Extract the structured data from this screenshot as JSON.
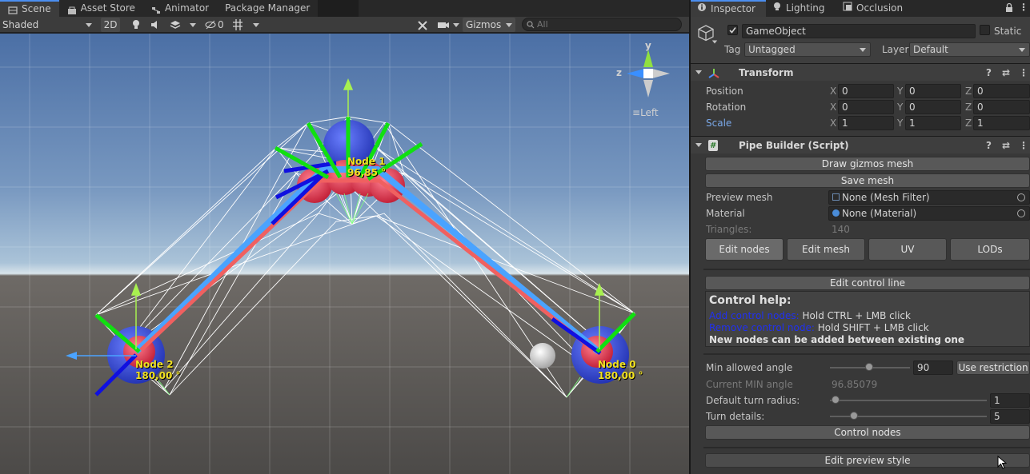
{
  "scene_panel": {
    "tabs": [
      {
        "label": "Scene",
        "icon": "scene-icon"
      },
      {
        "label": "Asset Store",
        "icon": "asset-store-icon"
      },
      {
        "label": "Animator",
        "icon": "animator-icon"
      },
      {
        "label": "Package Manager",
        "icon": ""
      }
    ],
    "toolbar": {
      "draw_mode": "Shaded",
      "mode_2d": "2D",
      "hidden_count": "0",
      "gizmos": "Gizmos",
      "search_placeholder": "All"
    },
    "orientation_gizmo": {
      "y": "y",
      "z": "z",
      "view_label": "Left"
    },
    "nodes": [
      {
        "name": "Node 1",
        "angle": "96,85 °"
      },
      {
        "name": "Node 2",
        "angle": "180,00 °"
      },
      {
        "name": "Node 0",
        "angle": "180,00 °"
      }
    ]
  },
  "inspector": {
    "tabs": [
      {
        "label": "Inspector",
        "icon": "info-icon"
      },
      {
        "label": "Lighting",
        "icon": "lightbulb-icon"
      },
      {
        "label": "Occlusion",
        "icon": "occlusion-icon"
      }
    ],
    "object": {
      "name": "GameObject",
      "active": true,
      "static_label": "Static",
      "tag_label": "Tag",
      "tag_value": "Untagged",
      "layer_label": "Layer",
      "layer_value": "Default"
    },
    "transform": {
      "title": "Transform",
      "rows": [
        {
          "label": "Position",
          "x": "0",
          "y": "0",
          "z": "0"
        },
        {
          "label": "Rotation",
          "x": "0",
          "y": "0",
          "z": "0"
        },
        {
          "label": "Scale",
          "x": "1",
          "y": "1",
          "z": "1"
        }
      ],
      "axis_x": "X",
      "axis_y": "Y",
      "axis_z": "Z"
    },
    "pipe_builder": {
      "title": "Pipe Builder (Script)",
      "draw_gizmos_mesh": "Draw gizmos mesh",
      "save_mesh": "Save mesh",
      "preview_mesh_label": "Preview mesh",
      "preview_mesh_value": "None (Mesh Filter)",
      "material_label": "Material",
      "material_value": "None (Material)",
      "triangles_label": "Triangles:",
      "triangles_value": "140",
      "mode_tabs": [
        "Edit nodes",
        "Edit mesh",
        "UV",
        "LODs"
      ],
      "edit_control_line": "Edit control line",
      "help_title": "Control help:",
      "help_add_key": "Add control nodes:",
      "help_add_value": "Hold CTRL + LMB click",
      "help_remove_key": "Remove control node:",
      "help_remove_value": "Hold SHIFT + LMB click",
      "help_note": "New nodes can be added between existing one",
      "min_angle_label": "Min allowed angle",
      "min_angle_value": "90",
      "min_angle_slider": 0.5,
      "use_restriction": "Use restriction",
      "current_min_label": "Current MIN angle",
      "current_min_value": "96.85079",
      "turn_radius_label": "Default turn radius:",
      "turn_radius_value": "1",
      "turn_radius_slider": 0.0,
      "turn_details_label": "Turn details:",
      "turn_details_value": "5",
      "turn_details_slider": 0.1,
      "control_nodes": "Control nodes",
      "edit_preview_style": "Edit preview style"
    }
  }
}
